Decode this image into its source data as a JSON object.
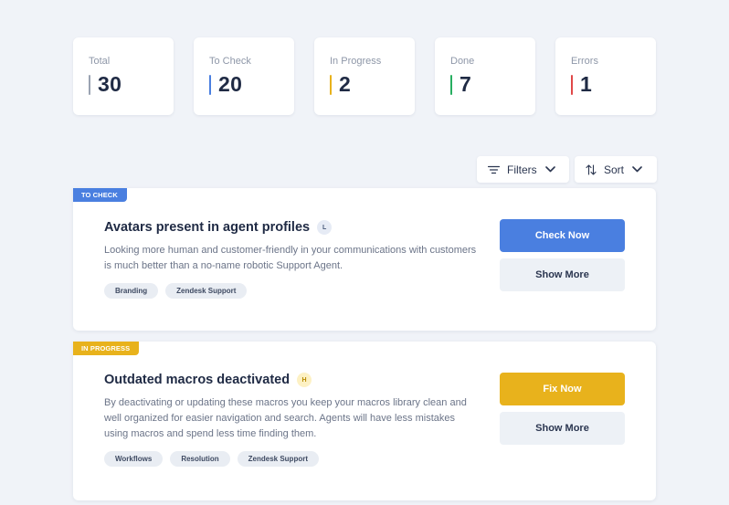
{
  "stats": [
    {
      "label": "Total",
      "value": "30",
      "color": "#9aa3b2"
    },
    {
      "label": "To Check",
      "value": "20",
      "color": "#4a7fe0"
    },
    {
      "label": "In Progress",
      "value": "2",
      "color": "#e8b21c"
    },
    {
      "label": "Done",
      "value": "7",
      "color": "#27ae60"
    },
    {
      "label": "Errors",
      "value": "1",
      "color": "#e04848"
    }
  ],
  "toolbar": {
    "filters_label": "Filters",
    "sort_label": "Sort",
    "filters_icon": "filter-lines-icon",
    "sort_icon": "sort-arrows-icon"
  },
  "cards": [
    {
      "status": "TO CHECK",
      "status_color": "#4a7fe0",
      "title": "Avatars present in agent profiles",
      "level": "L",
      "level_bg": "#e6ebf5",
      "level_color": "#4a5a7a",
      "description": "Looking more human and customer-friendly in your communications with customers is much better than a no-name robotic Support Agent.",
      "tags": [
        "Branding",
        "Zendesk Support"
      ],
      "primary_label": "Check Now",
      "primary_color": "#4a7fe0",
      "secondary_label": "Show More"
    },
    {
      "status": "IN PROGRESS",
      "status_color": "#e8b21c",
      "title": "Outdated macros deactivated",
      "level": "H",
      "level_bg": "#fdf1c4",
      "level_color": "#b88a00",
      "description": "By deactivating or updating these macros you keep your macros library clean and well organized for easier navigation and search. Agents will have less mistakes using macros and spend less time finding them.",
      "tags": [
        "Workflows",
        "Resolution",
        "Zendesk Support"
      ],
      "primary_label": "Fix Now",
      "primary_color": "#e8b21c",
      "secondary_label": "Show More"
    }
  ]
}
